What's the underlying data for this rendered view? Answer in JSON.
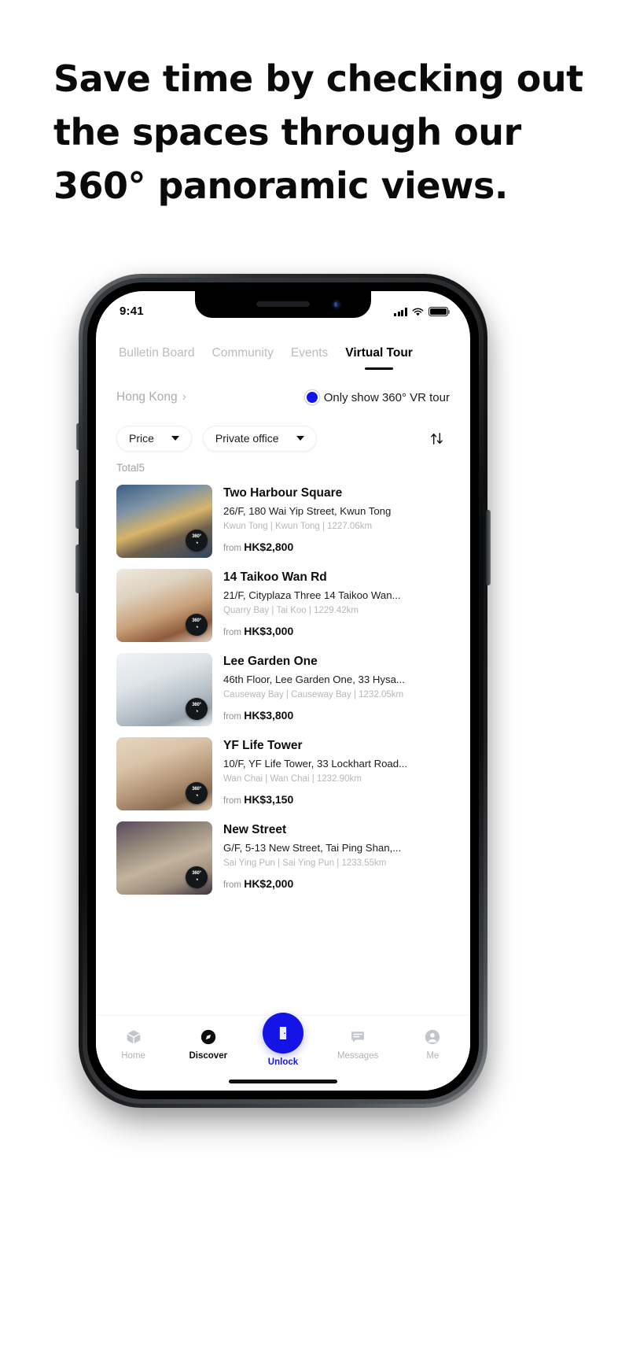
{
  "headline": {
    "line1": "Save time by checking out",
    "line2": "the spaces through our",
    "line3": "360° panoramic views."
  },
  "status_bar": {
    "time": "9:41",
    "signal_icon": "cellular-signal-icon",
    "wifi_icon": "wifi-icon",
    "battery_icon": "battery-icon"
  },
  "tabs": [
    {
      "label": "Bulletin Board",
      "active": false
    },
    {
      "label": "Community",
      "active": false
    },
    {
      "label": "Events",
      "active": false
    },
    {
      "label": "Virtual Tour",
      "active": true
    }
  ],
  "location": {
    "label": "Hong Kong",
    "chevron": "›"
  },
  "vr_filter": {
    "label": "Only show 360° VR tour",
    "checked": true,
    "accent": "#1414e6"
  },
  "filters": [
    {
      "label": "Price"
    },
    {
      "label": "Private office"
    }
  ],
  "sort": {
    "icon": "sort-arrows-icon"
  },
  "total_label": "Total5",
  "listings": [
    {
      "title": "Two Harbour Square",
      "address": "26/F, 180 Wai Yip Street, Kwun Tong",
      "meta": "Kwun Tong | Kwun Tong | 1227.06km",
      "price_prefix": "from",
      "price": "HK$2,800",
      "badge_top": "360°",
      "badge_bottom": "◔",
      "thumb_colors": [
        "#3c5e82",
        "#9ea7ad",
        "#d8b46a",
        "#2f4760"
      ]
    },
    {
      "title": "14 Taikoo Wan Rd",
      "address": "21/F, Cityplaza Three 14 Taikoo Wan...",
      "meta": "Quarry Bay | Tai Koo | 1229.42km",
      "price_prefix": "from",
      "price": "HK$3,000",
      "badge_top": "360°",
      "badge_bottom": "◔",
      "thumb_colors": [
        "#e8e0d4",
        "#c8a079",
        "#8d5a3b",
        "#efe9df"
      ]
    },
    {
      "title": "Lee Garden One",
      "address": "46th Floor, Lee Garden One, 33 Hysa...",
      "meta": "Causeway Bay | Causeway Bay | 1232.05km",
      "price_prefix": "from",
      "price": "HK$3,800",
      "badge_top": "360°",
      "badge_bottom": "◔",
      "thumb_colors": [
        "#dfe4e8",
        "#b9c3cb",
        "#8e9aa6",
        "#f2f4f6"
      ]
    },
    {
      "title": "YF Life Tower",
      "address": "10/F, YF Life Tower, 33 Lockhart Road...",
      "meta": "Wan Chai | Wan Chai | 1232.90km",
      "price_prefix": "from",
      "price": "HK$3,150",
      "badge_top": "360°",
      "badge_bottom": "◔",
      "thumb_colors": [
        "#d9c3a8",
        "#a8856a",
        "#e6d6c2",
        "#7d6450"
      ]
    },
    {
      "title": "New Street",
      "address": "G/F, 5-13 New Street, Tai Ping Shan,...",
      "meta": "Sai Ying Pun | Sai Ying Pun | 1233.55km",
      "price_prefix": "from",
      "price": "HK$2,000",
      "badge_top": "360°",
      "badge_bottom": "◔",
      "thumb_colors": [
        "#5a4a5e",
        "#9b8b7a",
        "#c4b49e",
        "#3b3340"
      ]
    }
  ],
  "bottom_nav": [
    {
      "label": "Home",
      "icon": "cube-icon",
      "state": "inactive"
    },
    {
      "label": "Discover",
      "icon": "compass-icon",
      "state": "active"
    },
    {
      "label": "Unlock",
      "icon": "door-icon",
      "state": "primary"
    },
    {
      "label": "Messages",
      "icon": "chat-bubble-icon",
      "state": "inactive"
    },
    {
      "label": "Me",
      "icon": "person-icon",
      "state": "inactive"
    }
  ]
}
